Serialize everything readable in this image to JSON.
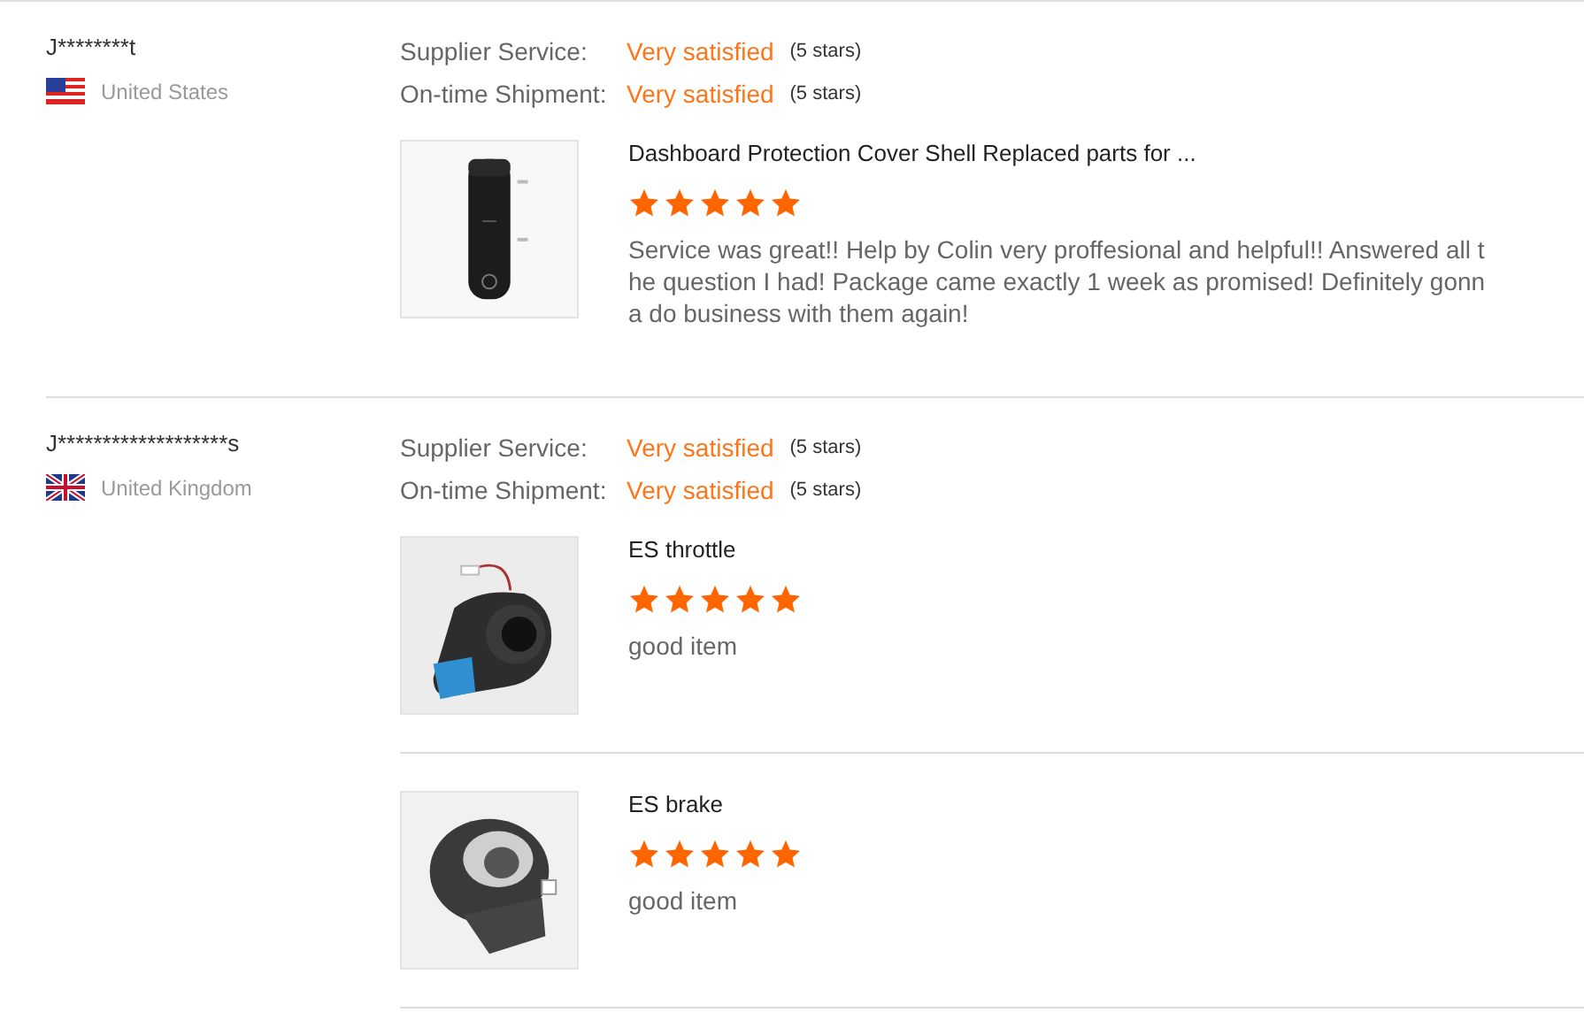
{
  "reviews": [
    {
      "reviewer": {
        "name": "J********t",
        "country": "United States",
        "kind": "us"
      },
      "ratings": [
        {
          "label": "Supplier Service:",
          "value": "Very satisfied",
          "note": "(5 stars)"
        },
        {
          "label": "On-time Shipment:",
          "value": "Very satisfied",
          "note": "(5 stars)"
        }
      ],
      "items": [
        {
          "title": "Dashboard Protection Cover Shell Replaced parts for ...",
          "stars": 5,
          "comment": "Service was great!! Help by Colin very proffesional and helpful!! Answered all the question I had! Package came exactly 1 week as promised! Definitely gonna do business with them again!",
          "kind": "dashboard"
        }
      ]
    },
    {
      "reviewer": {
        "name": "J*******************s",
        "country": "United Kingdom",
        "kind": "uk"
      },
      "ratings": [
        {
          "label": "Supplier Service:",
          "value": "Very satisfied",
          "note": "(5 stars)"
        },
        {
          "label": "On-time Shipment:",
          "value": "Very satisfied",
          "note": "(5 stars)"
        }
      ],
      "items": [
        {
          "title": "ES throttle",
          "stars": 5,
          "comment": "good item",
          "kind": "throttle"
        },
        {
          "title": "ES brake",
          "stars": 5,
          "comment": "good item",
          "kind": "brake"
        }
      ]
    }
  ]
}
